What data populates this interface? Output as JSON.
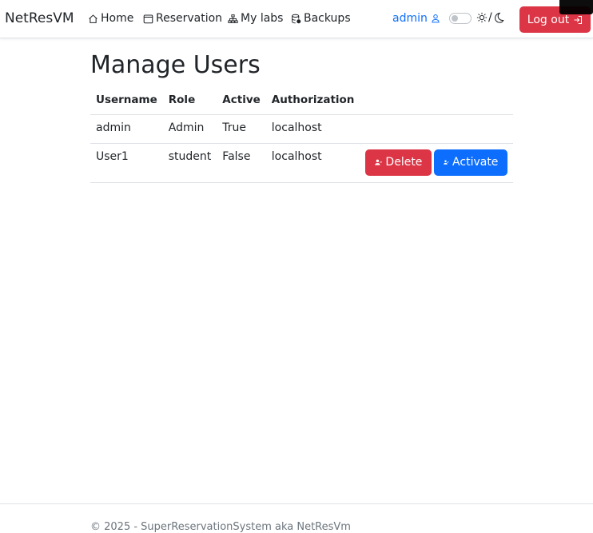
{
  "navbar": {
    "brand": "NetResVM",
    "links": [
      {
        "label": "Home",
        "icon": "house-icon"
      },
      {
        "label": "Reservation",
        "icon": "calendar-icon"
      },
      {
        "label": "My labs",
        "icon": "diagram-icon"
      },
      {
        "label": "Backups",
        "icon": "database-icon"
      }
    ],
    "user": {
      "label": "admin",
      "icon": "person-icon"
    },
    "theme_separator": "/",
    "logout_label": "Log out"
  },
  "main": {
    "title": "Manage Users",
    "columns": [
      "Username",
      "Role",
      "Active",
      "Authorization"
    ],
    "rows": [
      {
        "username": "admin",
        "role": "Admin",
        "active": "True",
        "authorization": "localhost"
      },
      {
        "username": "User1",
        "role": "student",
        "active": "False",
        "authorization": "localhost",
        "actions": {
          "delete_label": "Delete",
          "activate_label": "Activate"
        }
      }
    ]
  },
  "footer": {
    "text": "© 2025 - SuperReservationSystem aka NetResVm"
  },
  "colors": {
    "danger": "#dc3545",
    "primary": "#0d6efd",
    "user_link": "#0d6efd"
  }
}
